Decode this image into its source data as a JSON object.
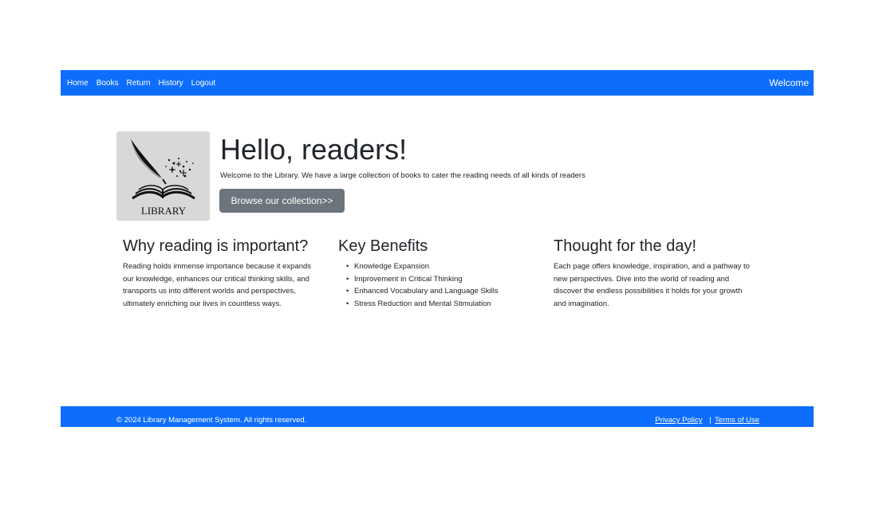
{
  "navbar": {
    "links": [
      "Home",
      "Books",
      "Return",
      "History",
      "Logout"
    ],
    "welcome": "Welcome"
  },
  "hero": {
    "logo_text": "LIBRARY",
    "title": "Hello, readers!",
    "text": "Welcome to the Library. We have a large collection of books to cater the reading needs of all kinds of readers",
    "button_label": "Browse our collection>>"
  },
  "sections": {
    "why": {
      "heading": "Why reading is important?",
      "body": "Reading holds immense importance because it expands our knowledge, enhances our critical thinking skills, and transports us into different worlds and perspectives, ultimately enriching our lives in countless ways."
    },
    "benefits": {
      "heading": "Key Benefits",
      "items": [
        "Knowledge Expansion",
        "Improvement in Critical Thinking",
        "Enhanced Vocabulary and Language Skills",
        "Stress Reduction and Mental Stimulation"
      ]
    },
    "thought": {
      "heading": "Thought for the day!",
      "body": "Each page offers knowledge, inspiration, and a pathway to new perspectives. Dive into the world of reading and discover the endless possibilities it holds for your growth and imagination."
    }
  },
  "footer": {
    "copyright": "© 2024 Library Management System. All rights reserved.",
    "privacy": "Privacy Policy",
    "separator": "|",
    "terms": "Terms of Use"
  },
  "colors": {
    "primary": "#0d6efd",
    "secondary": "#6c757d",
    "logo_bg": "#d8d8d8"
  },
  "icons": {
    "logo": "quill-and-open-book-logo"
  }
}
